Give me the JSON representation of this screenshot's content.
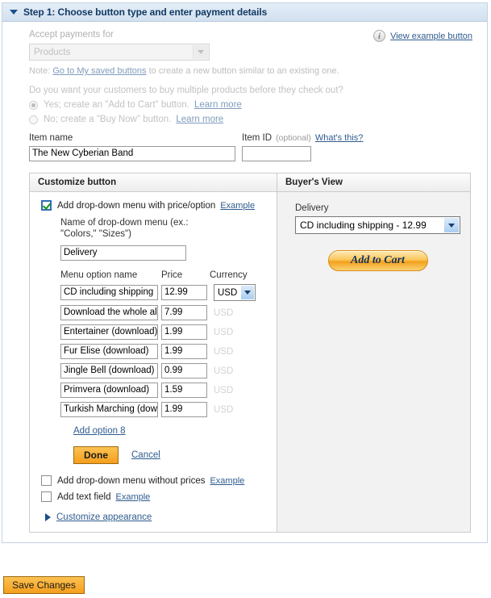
{
  "step": {
    "title": "Step 1: Choose button type and enter payment details",
    "toggle_icon": "triangle-down-icon"
  },
  "accept": {
    "label": "Accept payments for",
    "selected": "Products",
    "note_prefix": "Note:",
    "note_link": "Go to My saved buttons",
    "note_suffix": "to create a new button similar to an existing one.",
    "view_example_link": "View example button",
    "info_icon": "info-icon"
  },
  "multi": {
    "question": "Do you want your customers to buy multiple products before they check out?",
    "options": [
      {
        "label": "Yes; create an \"Add to Cart\" button.",
        "link": "Learn more",
        "checked": true
      },
      {
        "label": "No; create a \"Buy Now\" button.",
        "link": "Learn more",
        "checked": false
      }
    ]
  },
  "item": {
    "name_label": "Item name",
    "name_value": "The New Cyberian Band",
    "id_label": "Item ID",
    "id_optional": "(optional)",
    "id_help_link": "What's this?",
    "id_value": ""
  },
  "customize": {
    "panel_title": "Customize button",
    "dropdown_price_checkbox": {
      "label": "Add drop-down menu with price/option",
      "example_link": "Example",
      "checked": true
    },
    "menu_name_label": "Name of drop-down menu (ex.: \"Colors,\" \"Sizes\")",
    "menu_name_value": "Delivery",
    "columns": {
      "name": "Menu option name",
      "price": "Price",
      "currency": "Currency"
    },
    "options": [
      {
        "name": "CD including shipping",
        "price": "12.99",
        "currency": "USD",
        "currency_active": true
      },
      {
        "name": "Download the whole album",
        "price": "7.99",
        "currency": "USD",
        "currency_active": false
      },
      {
        "name": "Entertainer (download)",
        "price": "1.99",
        "currency": "USD",
        "currency_active": false
      },
      {
        "name": "Fur Elise (download)",
        "price": "1.99",
        "currency": "USD",
        "currency_active": false
      },
      {
        "name": "Jingle Bell (download)",
        "price": "0.99",
        "currency": "USD",
        "currency_active": false
      },
      {
        "name": "Primvera (download)",
        "price": "1.59",
        "currency": "USD",
        "currency_active": false
      },
      {
        "name": "Turkish Marching (download)",
        "price": "1.99",
        "currency": "USD",
        "currency_active": false
      }
    ],
    "add_option_link": "Add option 8",
    "done_label": "Done",
    "cancel_label": "Cancel",
    "dropdown_noprice_checkbox": {
      "label": "Add drop-down menu without prices",
      "example_link": "Example",
      "checked": false
    },
    "text_field_checkbox": {
      "label": "Add text field",
      "example_link": "Example",
      "checked": false
    },
    "customize_appearance_link": "Customize appearance"
  },
  "buyer": {
    "panel_title": "Buyer's View",
    "delivery_label": "Delivery",
    "delivery_selected": "CD including shipping - 12.99",
    "add_to_cart_label": "Add to Cart"
  },
  "footer": {
    "save_label": "Save Changes"
  }
}
